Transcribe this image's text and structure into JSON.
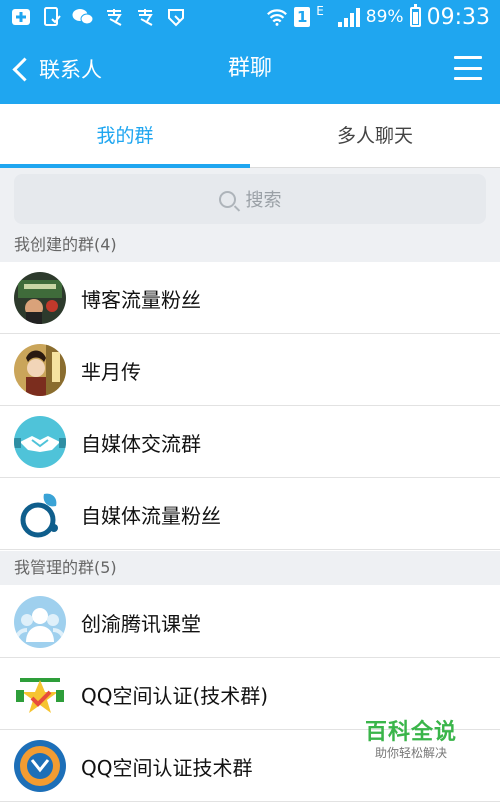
{
  "status_bar": {
    "battery_text": "89%",
    "battery_level": 0.89,
    "time": "09:33",
    "network": "E",
    "sim": "1"
  },
  "nav": {
    "back_label": "联系人",
    "title": "群聊",
    "menu_icon": "menu-icon"
  },
  "tabs": [
    {
      "label": "我的群",
      "active": true
    },
    {
      "label": "多人聊天",
      "active": false
    }
  ],
  "search": {
    "placeholder": "搜索"
  },
  "sections": [
    {
      "title": "我创建的群(4)",
      "items": [
        {
          "name": "博客流量粉丝"
        },
        {
          "name": "芈月传"
        },
        {
          "name": "自媒体交流群"
        },
        {
          "name": "自媒体流量粉丝"
        }
      ]
    },
    {
      "title": "我管理的群(5)",
      "items": [
        {
          "name": "创渝腾讯课堂"
        },
        {
          "name": "QQ空间认证(技术群)"
        },
        {
          "name": "QQ空间认证技术群"
        }
      ]
    }
  ],
  "watermark": {
    "title": "百科全说",
    "subtitle": "助你轻松解决"
  },
  "colors": {
    "primary": "#1fa6f0",
    "watermark_green": "#3ab54a"
  }
}
